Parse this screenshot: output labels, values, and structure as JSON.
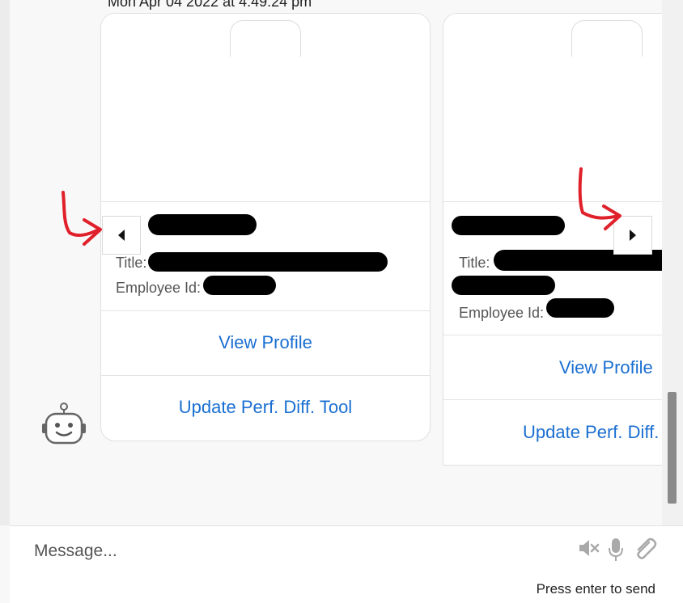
{
  "conversation": {
    "timestamp": "Mon Apr 04 2022 at 4:49:24 pm"
  },
  "cards": [
    {
      "title_label": "Title:",
      "employee_id_label": "Employee Id:",
      "view_profile_label": "View Profile",
      "update_tool_label": "Update Perf. Diff. Tool"
    },
    {
      "title_label": "Title:",
      "employee_id_label": "Employee Id:",
      "view_profile_label": "View Profile",
      "update_tool_label": "Update Perf. Diff. Tool"
    }
  ],
  "carousel": {
    "prev_icon": "caret-left-icon",
    "next_icon": "caret-right-icon"
  },
  "annotation": {
    "color": "#e0202a"
  },
  "composer": {
    "placeholder": "Message...",
    "send_hint": "Press enter to send",
    "icons": [
      "speaker-mute-icon",
      "microphone-icon",
      "paperclip-icon"
    ]
  },
  "colors": {
    "link": "#1a6fd1",
    "redaction": "#000000"
  }
}
